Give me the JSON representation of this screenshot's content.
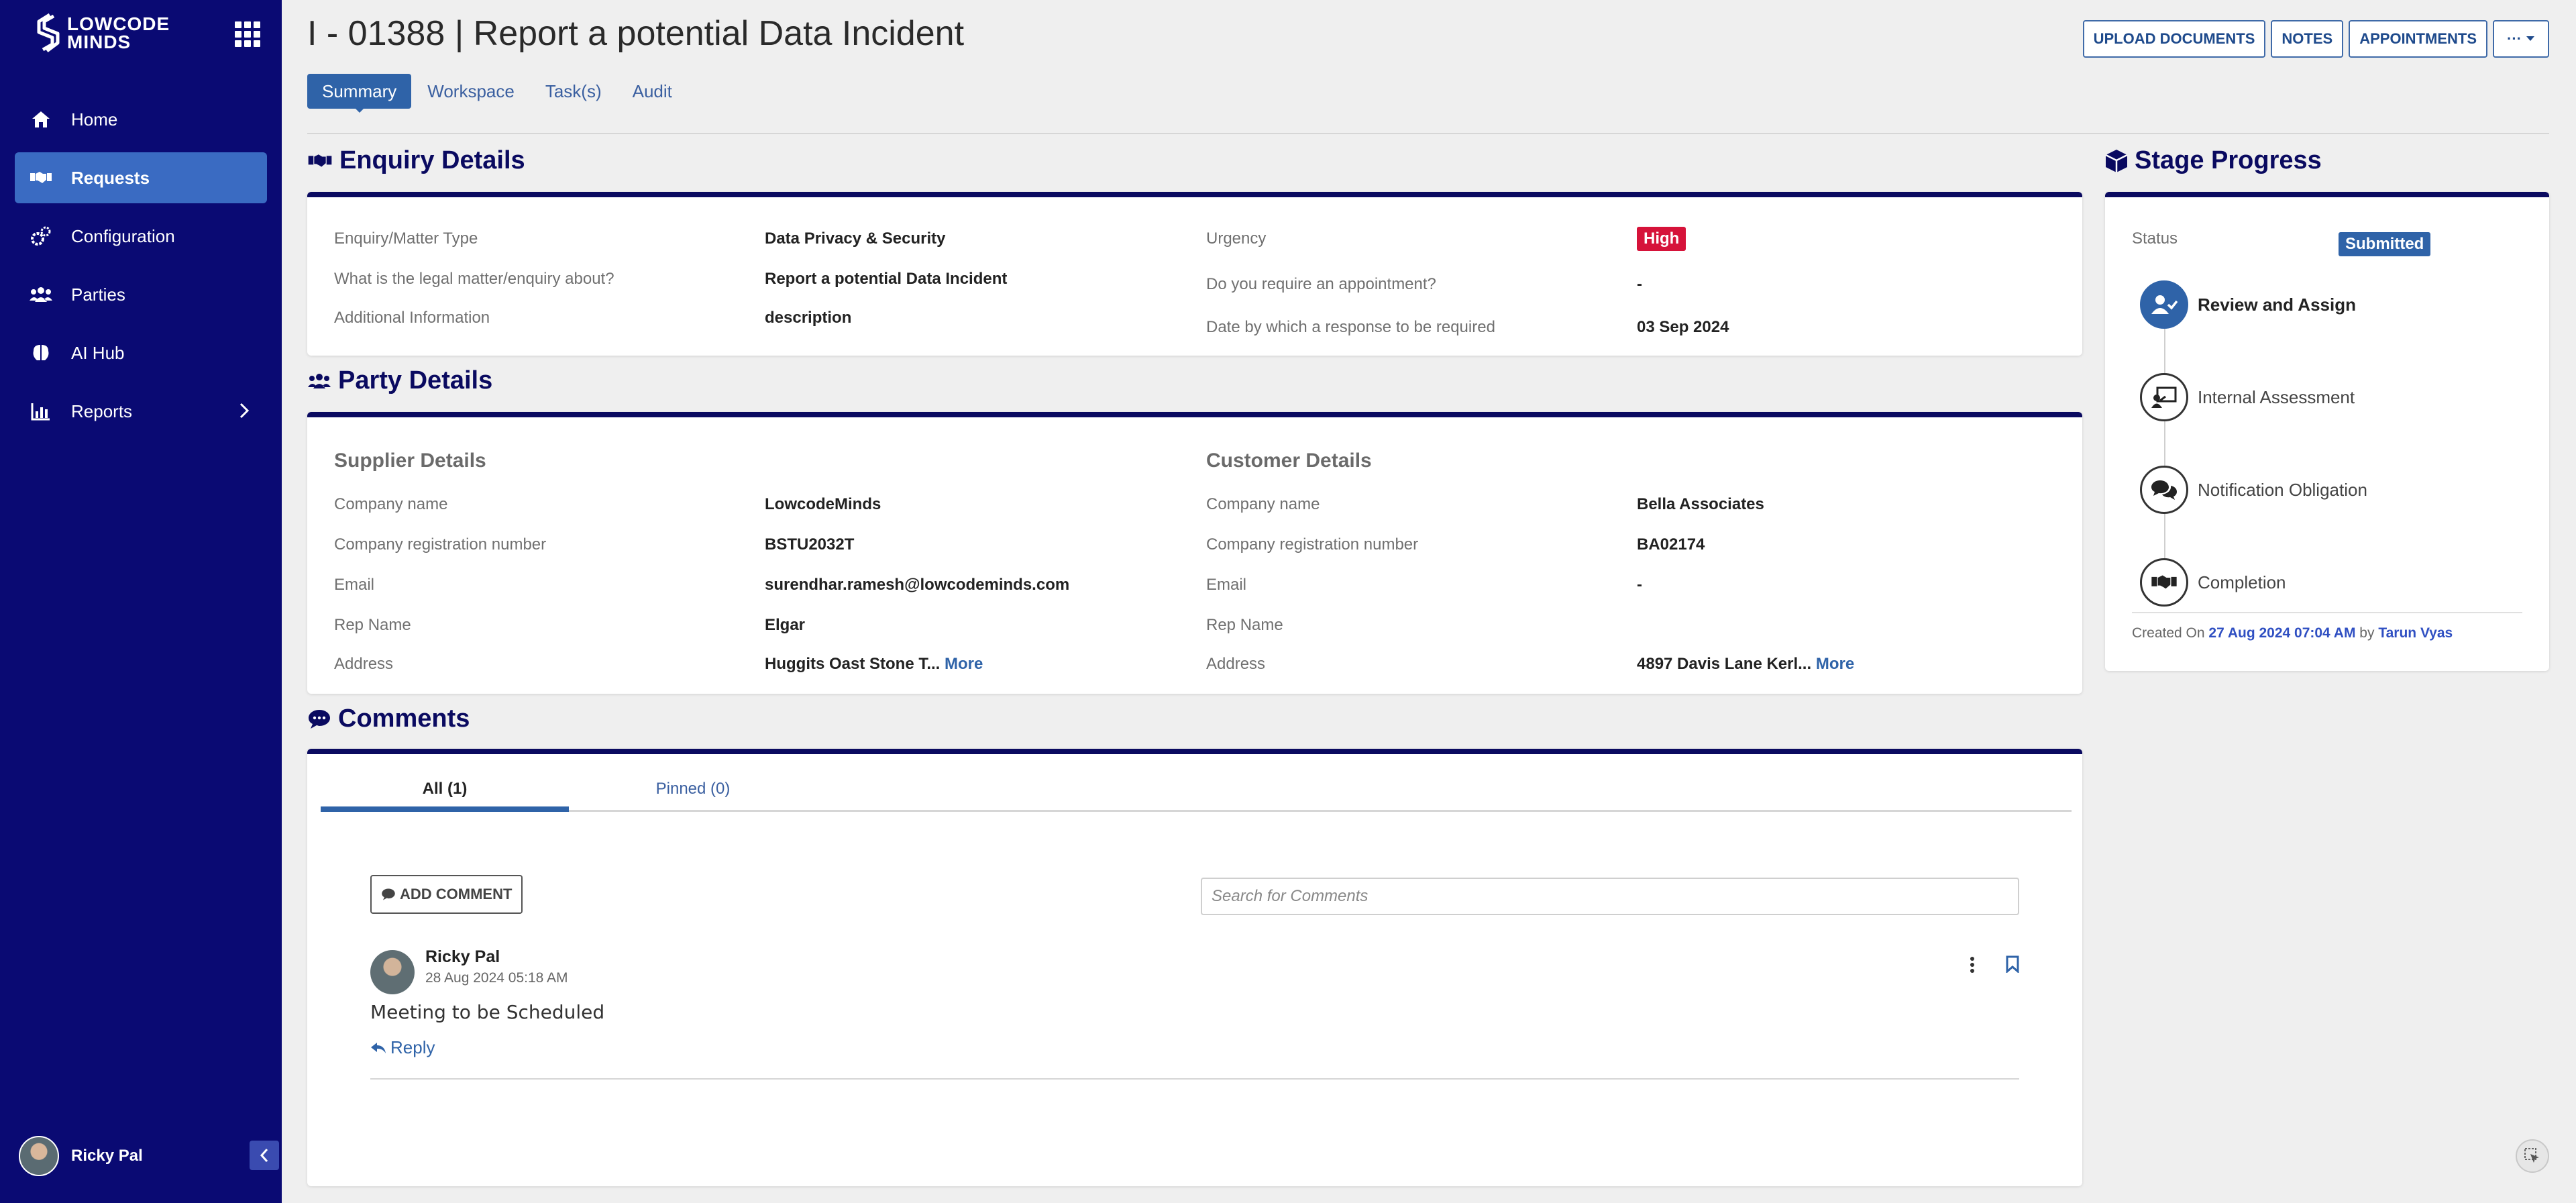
{
  "brand": {
    "logo_text_line1": "LOWCODE",
    "logo_text_line2": "MINDS",
    "sidebar_color": "#0a0a73",
    "accent": "#2f63a8"
  },
  "sidebar": {
    "items": [
      {
        "label": "Home",
        "icon": "home-icon",
        "active": false
      },
      {
        "label": "Requests",
        "icon": "handshake-icon",
        "active": true
      },
      {
        "label": "Configuration",
        "icon": "cogs-icon",
        "active": false
      },
      {
        "label": "Parties",
        "icon": "users-icon",
        "active": false
      },
      {
        "label": "AI Hub",
        "icon": "brain-icon",
        "active": false
      },
      {
        "label": "Reports",
        "icon": "bar-chart-icon",
        "active": false,
        "has_submenu": true
      }
    ],
    "user_name": "Ricky Pal"
  },
  "header": {
    "title": "I - 01388 | Report a potential Data Incident",
    "actions": {
      "upload": "UPLOAD DOCUMENTS",
      "notes": "NOTES",
      "appointments": "APPOINTMENTS",
      "more": "···"
    },
    "tabs": [
      "Summary",
      "Workspace",
      "Task(s)",
      "Audit"
    ],
    "active_tab": "Summary"
  },
  "enquiry": {
    "title": "Enquiry Details",
    "left": [
      {
        "label": "Enquiry/Matter Type",
        "value": "Data Privacy & Security"
      },
      {
        "label": "What is the legal matter/enquiry about?",
        "value": "Report a potential Data Incident"
      },
      {
        "label": "Additional Information",
        "value": "description"
      }
    ],
    "right": [
      {
        "label": "Urgency",
        "value": "High",
        "badge_color": "#d6133a"
      },
      {
        "label": "Do you require an appointment?",
        "value": "-"
      },
      {
        "label": "Date by which a response to be required",
        "value": "03 Sep 2024"
      }
    ]
  },
  "party": {
    "title": "Party Details",
    "supplier": {
      "heading": "Supplier Details",
      "rows": [
        {
          "label": "Company name",
          "value": "LowcodeMinds"
        },
        {
          "label": "Company registration number",
          "value": "BSTU2032T"
        },
        {
          "label": "Email",
          "value": "surendhar.ramesh@lowcodeminds.com"
        },
        {
          "label": "Rep Name",
          "value": "Elgar"
        },
        {
          "label": "Address",
          "value": "Huggits Oast Stone T...",
          "more": "More"
        }
      ]
    },
    "customer": {
      "heading": "Customer Details",
      "rows": [
        {
          "label": "Company name",
          "value": "Bella Associates"
        },
        {
          "label": "Company registration number",
          "value": "BA02174"
        },
        {
          "label": "Email",
          "value": "-"
        },
        {
          "label": "Rep Name",
          "value": ""
        },
        {
          "label": "Address",
          "value": "4897 Davis Lane Kerl...",
          "more": "More"
        }
      ]
    }
  },
  "comments": {
    "title": "Comments",
    "tabs": {
      "all": "All (1)",
      "pinned": "Pinned (0)"
    },
    "add_button": "ADD COMMENT",
    "search_placeholder": "Search for Comments",
    "items": [
      {
        "author": "Ricky Pal",
        "time": "28 Aug 2024 05:18 AM",
        "text": "Meeting to be Scheduled",
        "reply": "Reply"
      }
    ]
  },
  "stage_progress": {
    "title": "Stage Progress",
    "status_label": "Status",
    "status_value": "Submitted",
    "status_color": "#2f63a8",
    "stages": [
      {
        "label": "Review and Assign",
        "icon": "user-check-icon",
        "active": true
      },
      {
        "label": "Internal Assessment",
        "icon": "presentation-icon",
        "active": false
      },
      {
        "label": "Notification Obligation",
        "icon": "chat-bubbles-icon",
        "active": false
      },
      {
        "label": "Completion",
        "icon": "handshake-icon",
        "active": false
      }
    ],
    "created_prefix": "Created On",
    "created_on": "27 Aug 2024 07:04 AM",
    "created_by_word": "by",
    "created_by": "Tarun Vyas"
  }
}
